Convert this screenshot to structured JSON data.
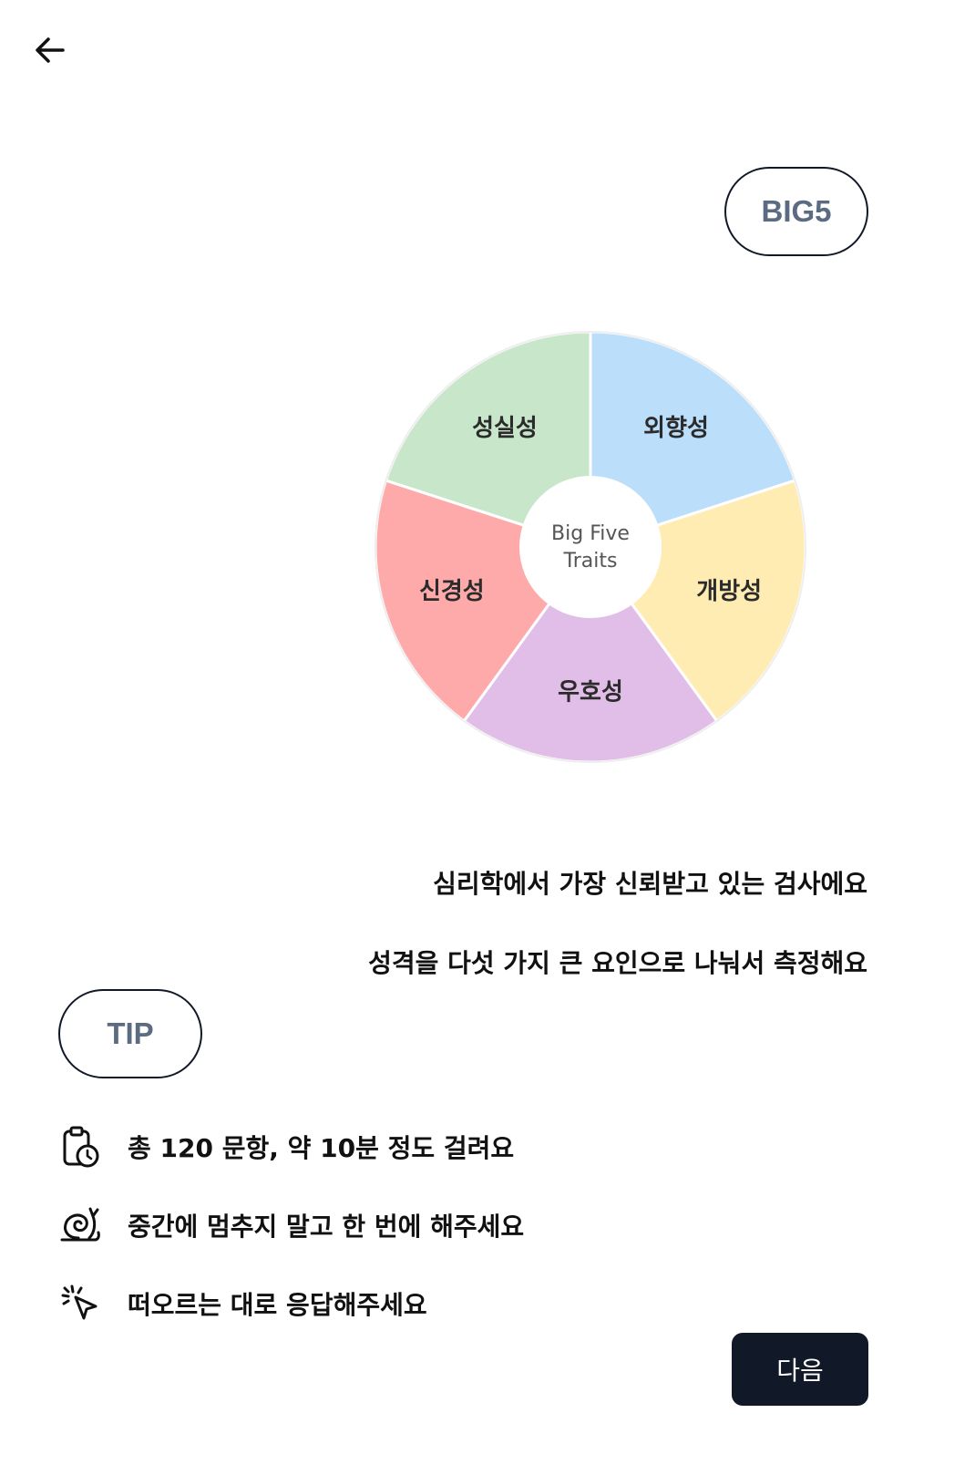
{
  "header": {
    "back_icon": "arrow-left-icon"
  },
  "badge": {
    "label": "BIG5"
  },
  "chart_data": {
    "type": "pie",
    "title": "",
    "center_label": [
      "Big Five",
      "Traits"
    ],
    "categories": [
      "외향성",
      "개방성",
      "우호성",
      "신경성",
      "성실성"
    ],
    "values": [
      20,
      20,
      20,
      20,
      20
    ],
    "colors": [
      "#bbdefb",
      "#ffecb3",
      "#e1bee7",
      "#ffaaaa",
      "#c8e6c9"
    ],
    "legend": "none"
  },
  "description": {
    "line1": "심리학에서 가장 신뢰받고 있는 검사에요",
    "line2": "성격을 다섯 가지 큰 요인으로 나눠서 측정해요"
  },
  "tip": {
    "label": "TIP",
    "items": [
      {
        "icon": "clipboard-clock-icon",
        "text": "총 120 문항, 약 10분 정도 걸려요"
      },
      {
        "icon": "snail-icon",
        "text": "중간에 멈추지 말고 한 번에 해주세요"
      },
      {
        "icon": "cursor-click-icon",
        "text": "떠오르는 대로 응답해주세요"
      }
    ]
  },
  "footer": {
    "next_label": "다음"
  },
  "colors": {
    "primary": "#111827",
    "pill_text": "#5b6b82"
  }
}
